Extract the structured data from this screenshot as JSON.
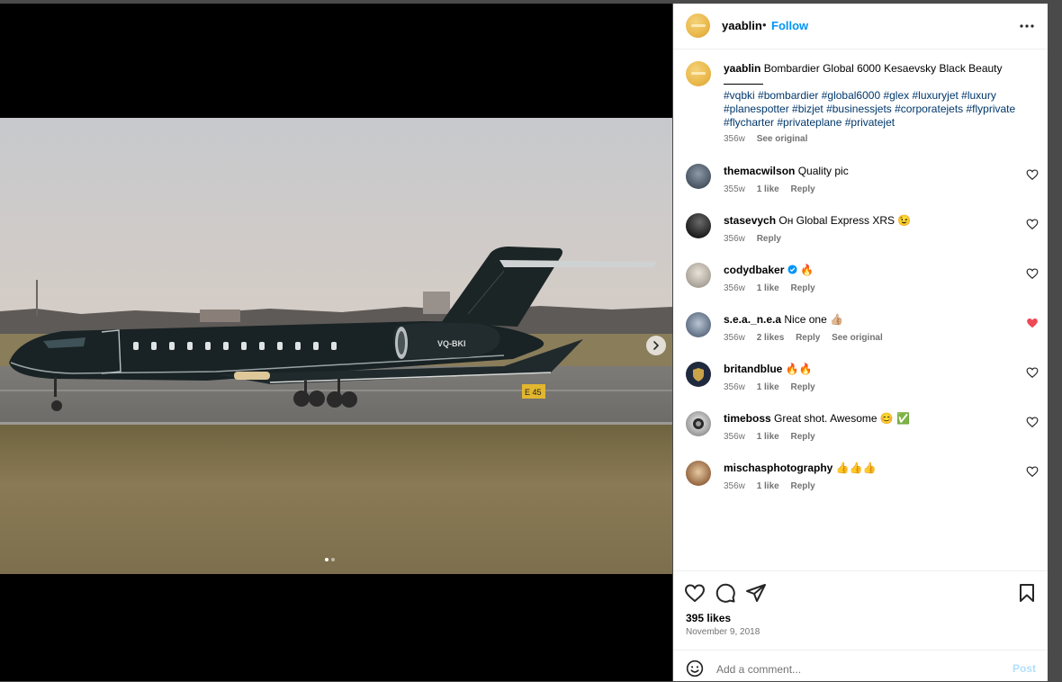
{
  "post": {
    "username": "yaablin",
    "separator": "•",
    "follow_label": "Follow",
    "caption": {
      "title": "Bombardier Global 6000 Kesaevsky Black Beauty",
      "tag_lines": [
        "#vqbki #bombardier #global6000 #glex #luxuryjet #luxury",
        "#planespotter #bizjet #businessjets #corporatejets #flyprivate",
        "#flycharter #privateplane #privatejet"
      ],
      "age": "356w",
      "see_original": "See original"
    },
    "media": {
      "registration": "VQ-BKI",
      "sign_text": "E 45",
      "slide_count": 2,
      "active_slide": 1
    }
  },
  "comments": [
    {
      "username": "themacwilson",
      "text": "Quality pic",
      "age": "355w",
      "likes": "1 like",
      "reply": "Reply",
      "liked": false
    },
    {
      "username": "stasevych",
      "text": "Он Global Express XRS 😉",
      "age": "356w",
      "reply": "Reply",
      "liked": false
    },
    {
      "username": "codydbaker",
      "verified": true,
      "text": "🔥",
      "age": "356w",
      "likes": "1 like",
      "reply": "Reply",
      "liked": false
    },
    {
      "username": "s.e.a._n.e.a",
      "text": "Nice one 👍🏼",
      "age": "356w",
      "likes": "2 likes",
      "reply": "Reply",
      "see_original": "See original",
      "liked": true
    },
    {
      "username": "britandblue",
      "text": "🔥🔥",
      "age": "356w",
      "likes": "1 like",
      "reply": "Reply",
      "liked": false
    },
    {
      "username": "timeboss",
      "text": "Great shot. Awesome 😊 ✅",
      "age": "356w",
      "likes": "1 like",
      "reply": "Reply",
      "liked": false
    },
    {
      "username": "mischasphotography",
      "text": "👍👍👍",
      "age": "356w",
      "likes": "1 like",
      "reply": "Reply",
      "liked": false
    }
  ],
  "footer": {
    "likes": "395 likes",
    "date": "November 9, 2018",
    "comment_placeholder": "Add a comment...",
    "post_label": "Post"
  },
  "icons": {
    "more": "more-options-icon",
    "heart": "heart-icon",
    "comment": "comment-icon",
    "share": "share-icon",
    "save": "bookmark-icon",
    "emoji": "emoji-icon",
    "next": "chevron-right-icon",
    "verified": "verified-badge-icon"
  },
  "colors": {
    "link": "#0095f6",
    "hashtag": "#00376b",
    "liked_heart": "#ed4956",
    "post_disabled": "#b2dffc"
  }
}
